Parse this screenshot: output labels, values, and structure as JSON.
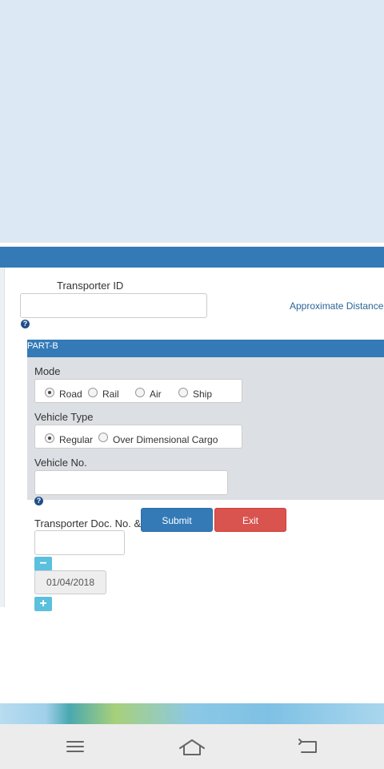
{
  "transporter": {
    "id_label": "Transporter ID",
    "id_value": "",
    "approx_distance_label": "Approximate Distance"
  },
  "partb": {
    "header": "PART-B",
    "mode_label": "Mode",
    "modes": [
      "Road",
      "Rail",
      "Air",
      "Ship"
    ],
    "selected_mode": "Road",
    "vehicle_type_label": "Vehicle Type",
    "vehicle_types": [
      "Regular",
      "Over Dimensional Cargo"
    ],
    "selected_vehicle_type": "Regular",
    "vehicle_no_label": "Vehicle No.",
    "vehicle_no_value": ""
  },
  "doc": {
    "label": "Transporter Doc. No. & D",
    "value": "",
    "date": "01/04/2018"
  },
  "buttons": {
    "submit": "Submit",
    "exit": "Exit"
  },
  "icons": {
    "help": "question-circle-icon",
    "minus": "minus-icon",
    "plus": "plus-icon",
    "nav_menu": "menu-icon",
    "nav_home": "home-icon",
    "nav_back": "back-icon"
  },
  "colors": {
    "primary": "#337ab7",
    "danger": "#d9534f",
    "info": "#5bc0de"
  }
}
